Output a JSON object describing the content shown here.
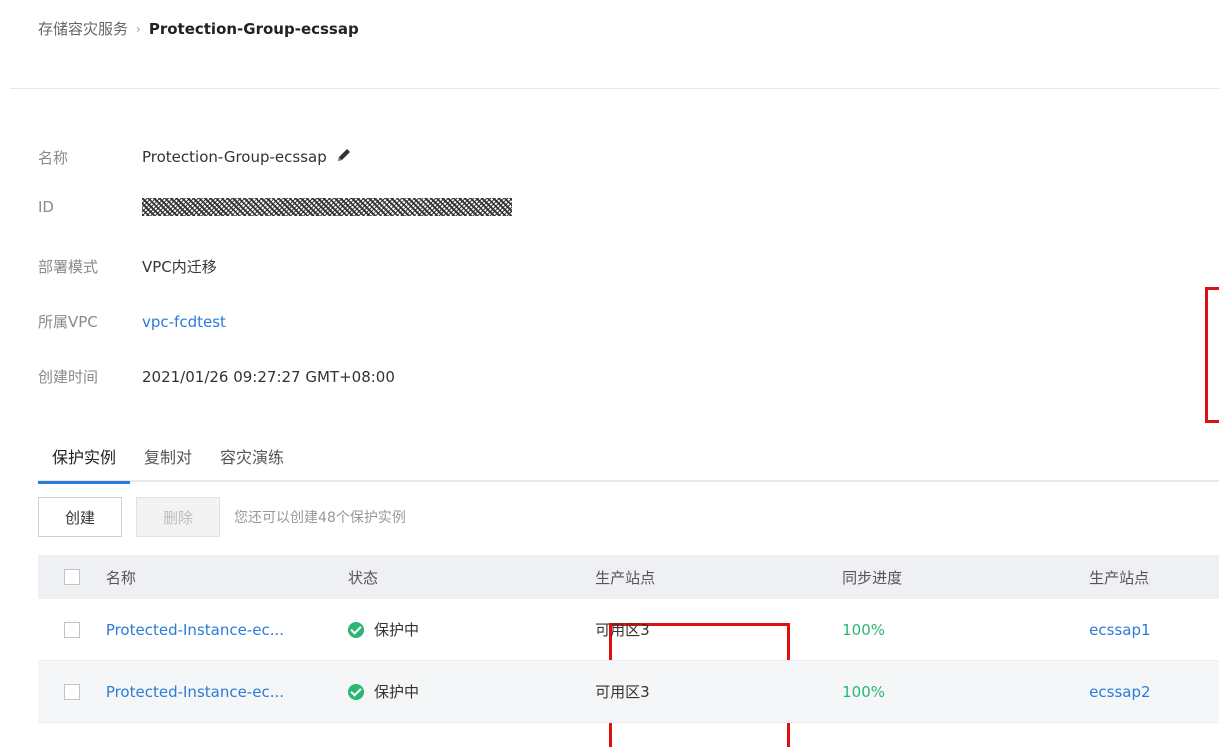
{
  "breadcrumb": {
    "service": "存储容灾服务",
    "separator": "›",
    "current": "Protection-Group-ecssap"
  },
  "details": {
    "name_label": "名称",
    "name_value": "Protection-Group-ecssap",
    "id_label": "ID",
    "deploy_label": "部署模式",
    "deploy_value": "VPC内迁移",
    "vpc_label": "所属VPC",
    "vpc_value": "vpc-fcdtest",
    "created_label": "创建时间",
    "created_value": "2021/01/26 09:27:27 GMT+08:00"
  },
  "tabs": [
    {
      "label": "保护实例",
      "active": true
    },
    {
      "label": "复制对",
      "active": false
    },
    {
      "label": "容灾演练",
      "active": false
    }
  ],
  "toolbar": {
    "create_label": "创建",
    "delete_label": "删除",
    "hint": "您还可以创建48个保护实例"
  },
  "table": {
    "headers": [
      "名称",
      "状态",
      "生产站点",
      "同步进度",
      "生产站点"
    ],
    "rows": [
      {
        "name": "Protected-Instance-ec...",
        "status": "保护中",
        "site": "可用区3",
        "sync": "100%",
        "prod": "ecssap1"
      },
      {
        "name": "Protected-Instance-ec...",
        "status": "保护中",
        "site": "可用区3",
        "sync": "100%",
        "prod": "ecssap2"
      }
    ]
  },
  "colors": {
    "accent": "#2b7bd9",
    "success": "#2bb673",
    "highlight": "#e01010"
  }
}
